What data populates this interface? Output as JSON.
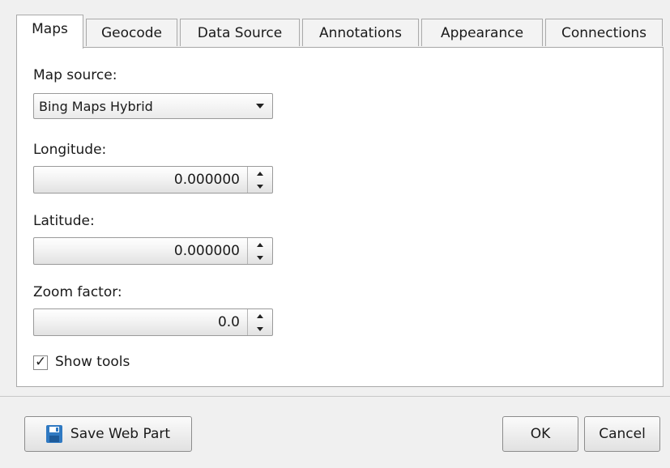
{
  "tabs": [
    {
      "label": "Maps"
    },
    {
      "label": "Geocode"
    },
    {
      "label": "Data Source"
    },
    {
      "label": "Annotations"
    },
    {
      "label": "Appearance"
    },
    {
      "label": "Connections"
    }
  ],
  "maps": {
    "map_source_label": "Map source:",
    "map_source_value": "Bing Maps Hybrid",
    "longitude_label": "Longitude:",
    "longitude_value": "0.000000",
    "latitude_label": "Latitude:",
    "latitude_value": "0.000000",
    "zoom_label": "Zoom factor:",
    "zoom_value": "0.0",
    "show_tools_label": "Show tools",
    "show_tools_checked": true
  },
  "footer": {
    "save_label": "Save Web Part",
    "ok_label": "OK",
    "cancel_label": "Cancel"
  },
  "icons": {
    "save": "floppy-disk-icon",
    "dropdown": "chevron-down-icon",
    "spin_up": "arrow-up-icon",
    "spin_down": "arrow-down-icon",
    "check": "checkmark-icon"
  },
  "colors": {
    "save_icon": "#2f79c2"
  }
}
